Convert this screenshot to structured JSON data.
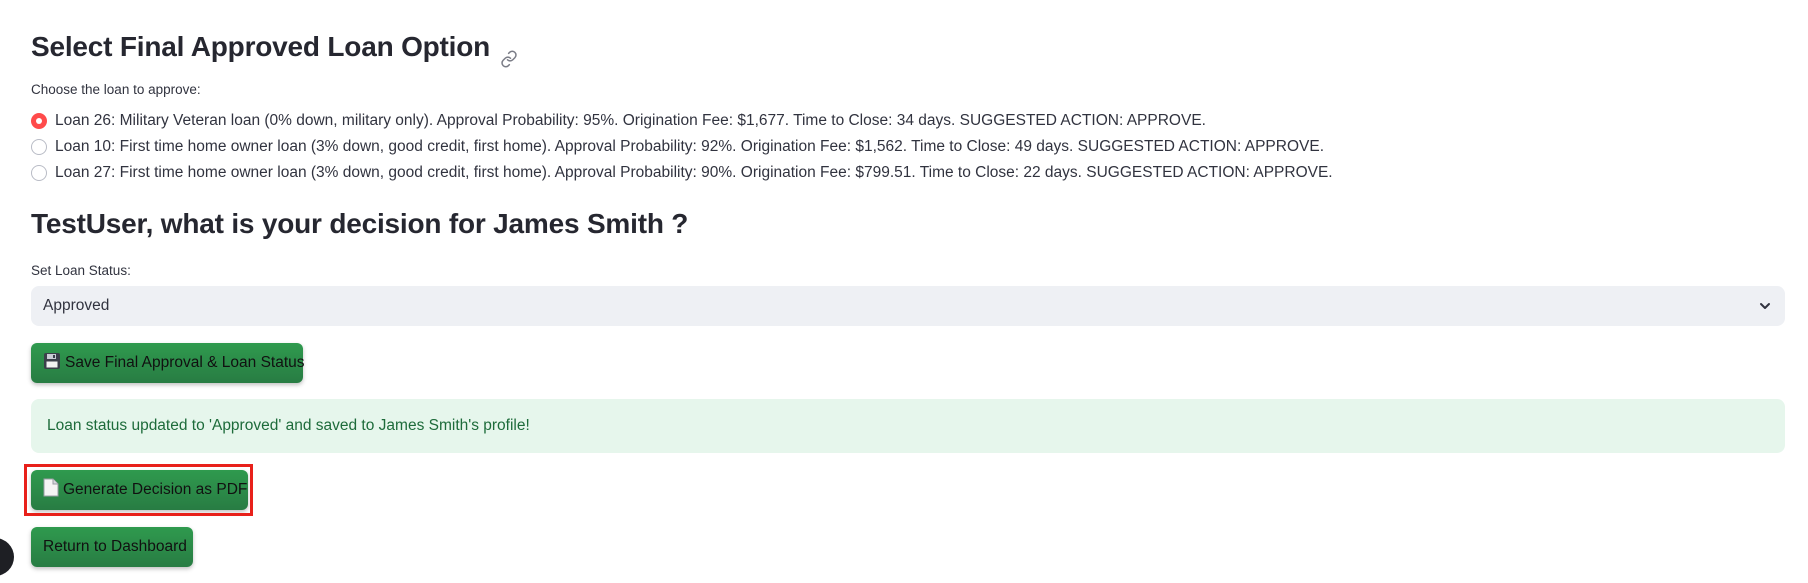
{
  "section1": {
    "title": "Select Final Approved Loan Option",
    "link_icon": "link-icon",
    "radio_label": "Choose the loan to approve:",
    "options": [
      {
        "label": "Loan 26: Military Veteran loan (0% down, military only). Approval Probability: 95%. Origination Fee: $1,677. Time to Close: 34 days. SUGGESTED ACTION: APPROVE.",
        "selected": true
      },
      {
        "label": "Loan 10: First time home owner loan (3% down, good credit, first home). Approval Probability: 92%. Origination Fee: $1,562. Time to Close: 49 days. SUGGESTED ACTION: APPROVE.",
        "selected": false
      },
      {
        "label": "Loan 27: First time home owner loan (3% down, good credit, first home). Approval Probability: 90%. Origination Fee: $799.51. Time to Close: 22 days. SUGGESTED ACTION: APPROVE.",
        "selected": false
      }
    ]
  },
  "section2": {
    "title": "TestUser, what is your decision for James Smith ?",
    "status_label": "Set Loan Status:",
    "status_value": "Approved",
    "save_button": "Save Final Approval & Loan Status",
    "save_icon": "floppy-disk-icon",
    "success_message": "Loan status updated to 'Approved' and saved to James Smith's profile!",
    "pdf_button": "Generate Decision as PDF",
    "pdf_icon": "document-icon",
    "dashboard_button": "Return to Dashboard"
  },
  "colors": {
    "accent_radio": "#ff4b4b",
    "button_green": "#2e8b4a",
    "success_bg": "#e6f6ec",
    "success_text": "#1d6b3a",
    "highlight": "#e8201a"
  }
}
